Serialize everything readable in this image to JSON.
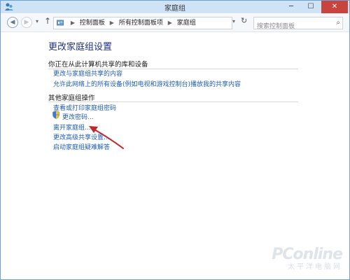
{
  "window": {
    "title": "家庭组",
    "controls": {
      "minimize": "─",
      "maximize": "☐",
      "close": "✕"
    }
  },
  "address_bar": {
    "breadcrumb": [
      "控制面板",
      "所有控制面板项",
      "家庭组"
    ],
    "search_placeholder": "搜索控制面板"
  },
  "content": {
    "page_title": "更改家庭组设置",
    "section_library": {
      "title": "你正在从此计算机共享的库和设备",
      "links": [
        "更改与家庭组共享的内容",
        "允许此网络上的所有设备(例如电视和游戏控制台)播放我的共享内容"
      ]
    },
    "section_actions": {
      "title": "其他家庭组操作",
      "links": [
        "查看或打印家庭组密码",
        "更改密码...",
        "离开家庭组...",
        "更改高级共享设置...",
        "启动家庭组疑难解答"
      ]
    }
  },
  "watermark": {
    "brand": "PConline",
    "sub": "太平洋电脑网"
  },
  "colors": {
    "link": "#1e5cb3",
    "title": "#1e3287",
    "arrow": "#c0282d",
    "close_button": "#c7453e"
  }
}
